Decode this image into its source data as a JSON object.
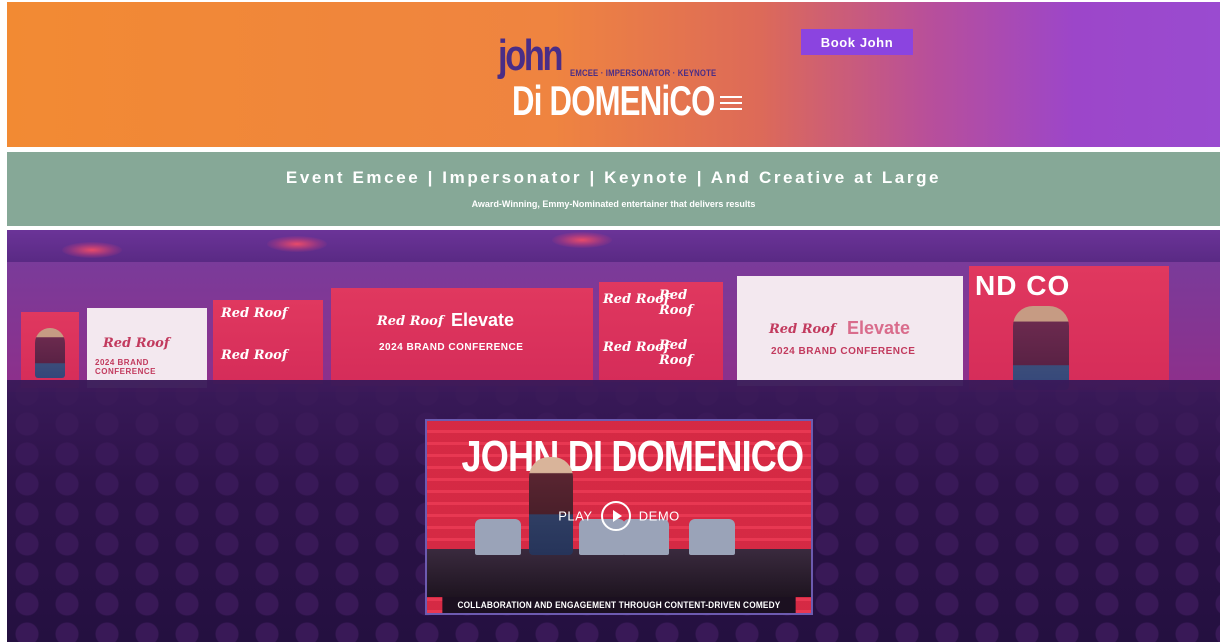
{
  "header": {
    "logo": {
      "first": "john",
      "tagline": "EMCEE · IMPERSONATOR · KEYNOTE",
      "last": "Di DOMENiCO"
    },
    "book_button": "Book John",
    "menu_icon": "hamburger-menu-icon",
    "colors": {
      "gradient_start": "#f28a33",
      "gradient_end": "#9a4bd0",
      "button": "#8b44e0",
      "logo_purple": "#4a2d86"
    }
  },
  "banner": {
    "title": "Event Emcee | Impersonator | Keynote | And Creative at Large",
    "subtitle": "Award-Winning, Emmy-Nominated entertainer that delivers results",
    "background": "#86a897"
  },
  "hero": {
    "stage_screens": {
      "brand": "Red Roof",
      "event": "Elevate",
      "conference": "2024 BRAND CONFERENCE",
      "partial_text": "ND CO"
    },
    "video": {
      "title": "JOHN DI DOMENICO",
      "play_left": "PLAY",
      "play_right": "DEMO",
      "play_icon": "play-circle-icon",
      "caption": "COLLABORATION AND ENGAGEMENT THROUGH CONTENT-DRIVEN COMEDY"
    }
  }
}
